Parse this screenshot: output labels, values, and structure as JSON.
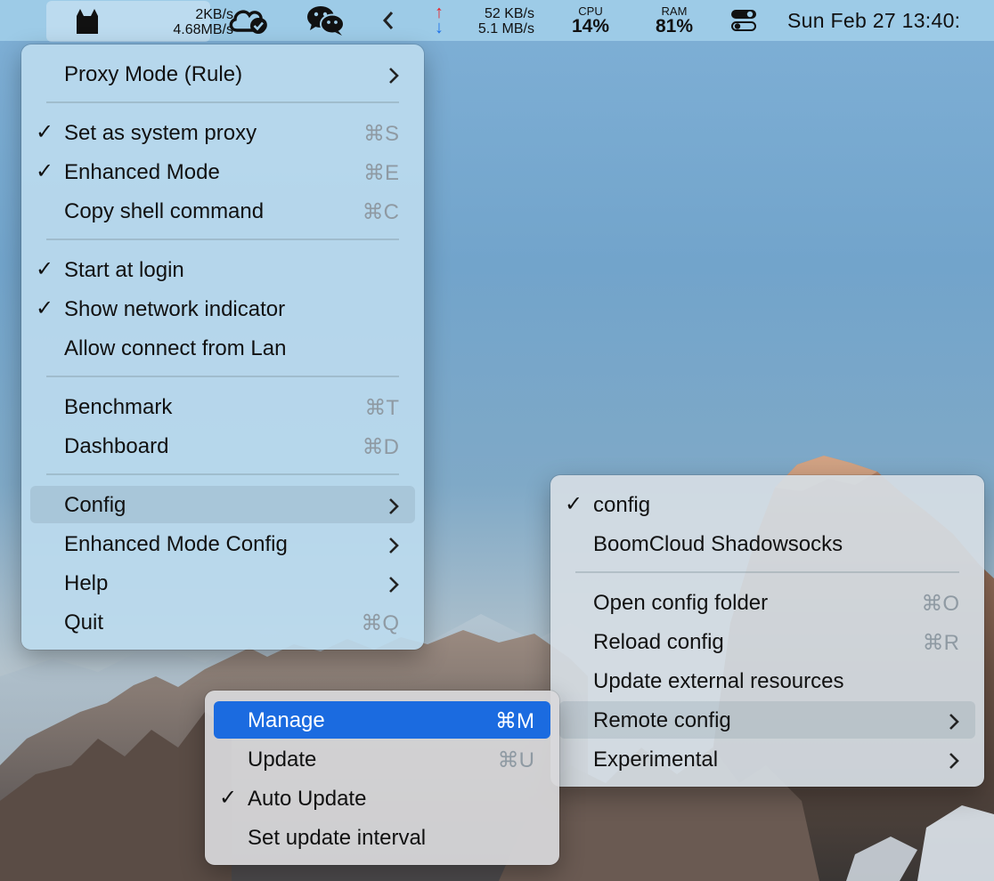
{
  "menubar": {
    "clash_upload": "2KB/s",
    "clash_download": "4.68MB/s",
    "net_up": "52 KB/s",
    "net_down": "5.1 MB/s",
    "cpu_label": "CPU",
    "cpu_value": "14%",
    "ram_label": "RAM",
    "ram_value": "81%",
    "clock": "Sun Feb 27  13:40:",
    "icons": [
      "clash-cat-icon",
      "cloud-check-icon",
      "wechat-icon",
      "chevron-left-icon",
      "arrow-up-icon",
      "arrow-down-icon",
      "control-center-icon"
    ],
    "colors": {
      "up_arrow": "#e8232a",
      "down_arrow": "#1d70e8"
    }
  },
  "main_menu": {
    "proxy_mode": "Proxy Mode (Rule)",
    "set_system_proxy": {
      "label": "Set as system proxy",
      "shortcut": "⌘S",
      "checked": true
    },
    "enhanced_mode": {
      "label": "Enhanced Mode",
      "shortcut": "⌘E",
      "checked": true
    },
    "copy_shell": {
      "label": "Copy shell command",
      "shortcut": "⌘C"
    },
    "start_at_login": {
      "label": "Start at login",
      "checked": true
    },
    "show_network_indicator": {
      "label": "Show network indicator",
      "checked": true
    },
    "allow_lan": {
      "label": "Allow connect from Lan"
    },
    "benchmark": {
      "label": "Benchmark",
      "shortcut": "⌘T"
    },
    "dashboard": {
      "label": "Dashboard",
      "shortcut": "⌘D"
    },
    "config": "Config",
    "enhanced_mode_config": "Enhanced Mode Config",
    "help": "Help",
    "quit": {
      "label": "Quit",
      "shortcut": "⌘Q"
    }
  },
  "config_submenu": {
    "config": {
      "label": "config",
      "checked": true
    },
    "boomcloud": "BoomCloud Shadowsocks",
    "open_folder": {
      "label": "Open config folder",
      "shortcut": "⌘O"
    },
    "reload": {
      "label": "Reload config",
      "shortcut": "⌘R"
    },
    "update_external": "Update external resources",
    "remote_config": "Remote config",
    "experimental": "Experimental"
  },
  "remote_submenu": {
    "manage": {
      "label": "Manage",
      "shortcut": "⌘M"
    },
    "update": {
      "label": "Update",
      "shortcut": "⌘U"
    },
    "auto_update": {
      "label": "Auto Update",
      "checked": true
    },
    "set_interval": "Set update interval"
  },
  "check_glyph": "✓",
  "accent_color": "#1b6be0"
}
